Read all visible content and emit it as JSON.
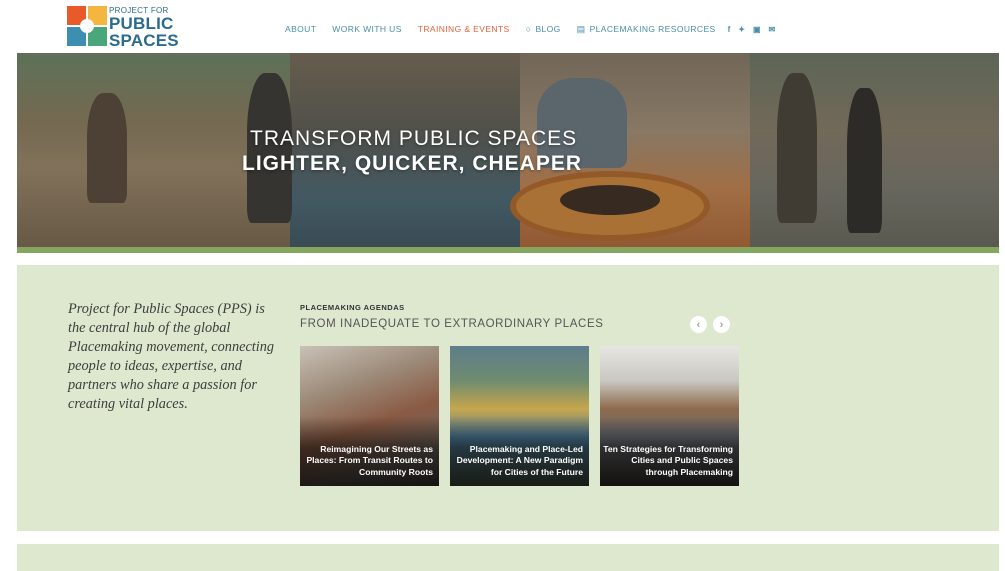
{
  "brand": {
    "logo_small": "PROJECT FOR",
    "logo_line1": "PUBLIC",
    "logo_line2": "SPACES"
  },
  "nav": {
    "items": [
      {
        "label": "ABOUT"
      },
      {
        "label": "WORK WITH US"
      },
      {
        "label": "TRAINING & EVENTS"
      },
      {
        "label": "BLOG"
      },
      {
        "label": "PLACEMAKING RESOURCES"
      }
    ],
    "social": [
      "f",
      "✦",
      "▣",
      "✉"
    ]
  },
  "hero": {
    "line1": "TRANSFORM PUBLIC SPACES",
    "line2": "LIGHTER, QUICKER, CHEAPER"
  },
  "intro": {
    "text": "Project for Public Spaces (PPS) is the central hub of the global Placemaking movement, connecting people to ideas, expertise, and partners who share a passion for creating vital places."
  },
  "agendas": {
    "label": "PLACEMAKING AGENDAS",
    "subtitle": "FROM INADEQUATE TO EXTRAORDINARY PLACES",
    "cards": [
      {
        "title": "Reimagining Our Streets as Places: From Transit Routes to Community Roots"
      },
      {
        "title": "Placemaking and Place-Led Development: A New Paradigm for Cities of the Future"
      },
      {
        "title": "Ten Strategies for Transforming Cities and Public Spaces through Placemaking"
      }
    ]
  },
  "colors": {
    "accent_active": "#e2633b",
    "nav": "#4a8ea8",
    "section_bg": "#dde8cf",
    "hero_strip": "#85a65f"
  }
}
